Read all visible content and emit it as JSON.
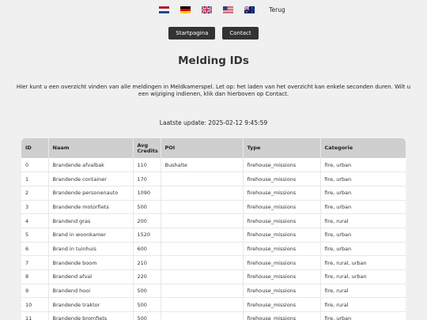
{
  "languages": [
    {
      "name": "nl-flag-icon"
    },
    {
      "name": "de-flag-icon"
    },
    {
      "name": "gb-flag-icon"
    },
    {
      "name": "us-flag-icon"
    },
    {
      "name": "au-flag-icon"
    }
  ],
  "back_label": "Terug",
  "nav": {
    "home_label": "Startpagina",
    "contact_label": "Contact"
  },
  "title": "Melding IDs",
  "intro": "Hier kunt u een overzicht vinden van alle meldingen in Meldkamerspel. Let op: het laden van het overzicht kan enkele seconden duren. Wilt u een wijziging indienen, klik dan hierboven op Contact.",
  "last_update": "Laatste update: 2025-02-12 9:45:59",
  "table": {
    "headers": [
      "ID",
      "Naam",
      "Avg Credits",
      "POI",
      "Type",
      "Categorie"
    ],
    "rows": [
      [
        "0",
        "Brandende afvalbak",
        "110",
        "Bushalte",
        "firehouse_missions",
        "fire, urban"
      ],
      [
        "1",
        "Brandende container",
        "170",
        "",
        "firehouse_missions",
        "fire, urban"
      ],
      [
        "2",
        "Brandende personenauto",
        "1090",
        "",
        "firehouse_missions",
        "fire, urban"
      ],
      [
        "3",
        "Brandende motorfiets",
        "500",
        "",
        "firehouse_missions",
        "fire, urban"
      ],
      [
        "4",
        "Brandend gras",
        "200",
        "",
        "firehouse_missions",
        "fire, rural"
      ],
      [
        "5",
        "Brand in woonkamer",
        "1520",
        "",
        "firehouse_missions",
        "fire, urban"
      ],
      [
        "6",
        "Brand in tuinhuis",
        "600",
        "",
        "firehouse_missions",
        "fire, urban"
      ],
      [
        "7",
        "Brandende boom",
        "210",
        "",
        "firehouse_missions",
        "fire, rural, urban"
      ],
      [
        "8",
        "Brandend afval",
        "220",
        "",
        "firehouse_missions",
        "fire, rural, urban"
      ],
      [
        "9",
        "Brandend hooi",
        "500",
        "",
        "firehouse_missions",
        "fire, rural"
      ],
      [
        "10",
        "Brandende traktor",
        "500",
        "",
        "firehouse_missions",
        "fire, rural"
      ],
      [
        "11",
        "Brandende bromfiets",
        "500",
        "",
        "firehouse_missions",
        "fire, urban"
      ]
    ]
  }
}
